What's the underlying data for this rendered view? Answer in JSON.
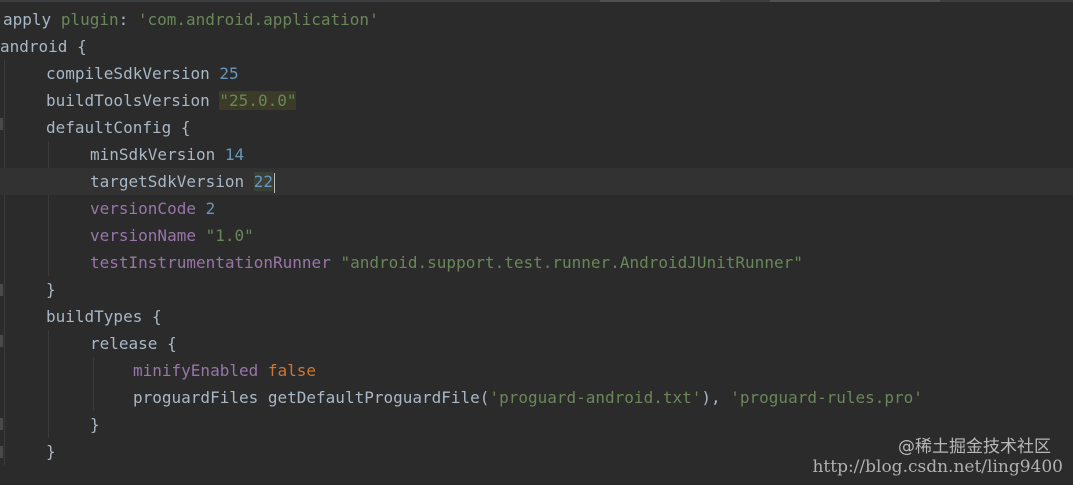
{
  "code": {
    "l1_apply": "apply",
    "l1_plugin": "plugin",
    "l1_colon": ": ",
    "l1_str": "'com.android.application'",
    "l2_android": "android {",
    "l3_key": "compileSdkVersion",
    "l3_val": "25",
    "l4_key": "buildToolsVersion",
    "l4_val": "\"25.0.0\"",
    "l5_key": "defaultConfig {",
    "l6_key": "minSdkVersion",
    "l6_val": "14",
    "l7_key": "targetSdkVersion",
    "l7_val": "22",
    "l8_key": "versionCode",
    "l8_val": "2",
    "l9_key": "versionName",
    "l9_val": "\"1.0\"",
    "l10_key": "testInstrumentationRunner",
    "l10_val": "\"android.support.test.runner.AndroidJUnitRunner\"",
    "l11_close": "}",
    "l12_key": "buildTypes {",
    "l13_key": "release {",
    "l14_key": "minifyEnabled",
    "l14_val": "false",
    "l15_key": "proguardFiles",
    "l15_fn": "getDefaultProguardFile(",
    "l15_arg1": "'proguard-android.txt'",
    "l15_sep": "), ",
    "l15_arg2": "'proguard-rules.pro'",
    "l16_close": "}",
    "l17_close": "}"
  },
  "watermark": {
    "handle": "@稀土掘金技术社区",
    "url": "http://blog.csdn.net/ling9400"
  },
  "colors": {
    "background": "#2b2b2b",
    "keyword": "#cc7832",
    "string": "#6a8759",
    "number": "#6897bb",
    "property": "#9876aa",
    "text": "#a9b7c6"
  }
}
